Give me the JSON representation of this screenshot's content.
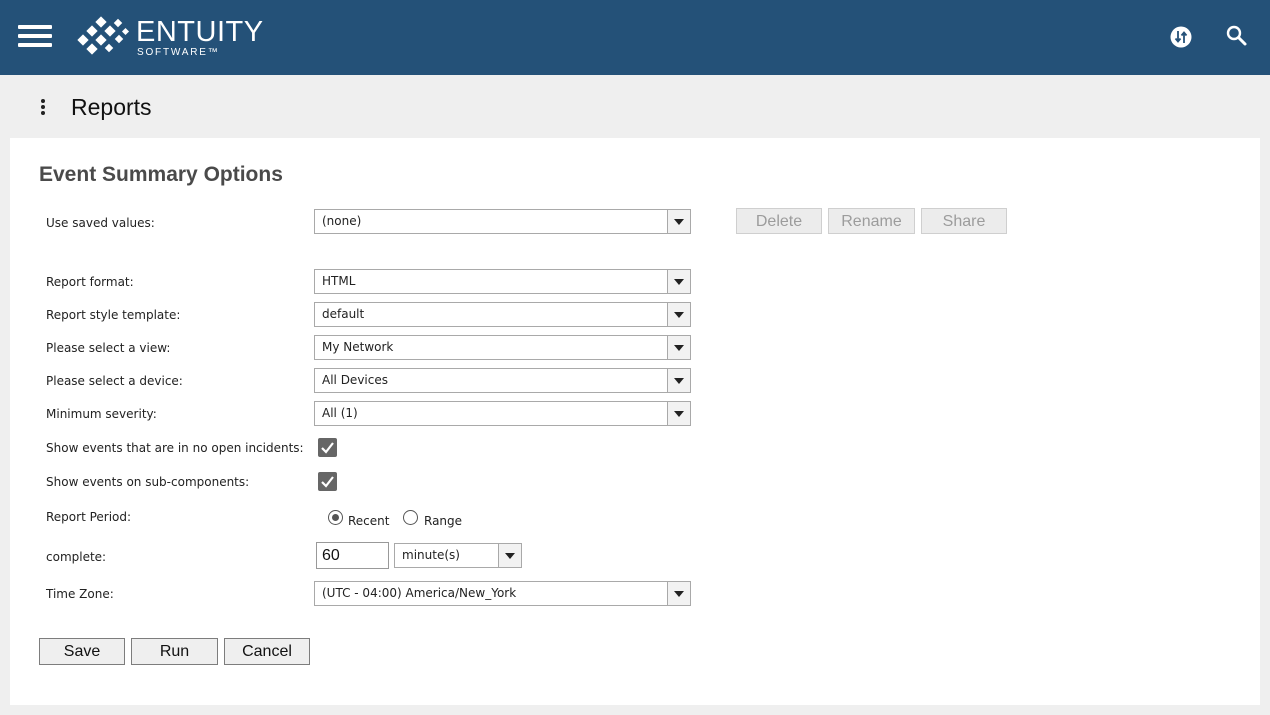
{
  "header": {
    "brand_name": "ENTUITY",
    "brand_sub": "SOFTWARE™",
    "icons": [
      "menu-icon",
      "sync-icon",
      "search-icon"
    ]
  },
  "subheader": {
    "title": "Reports"
  },
  "form": {
    "title": "Event Summary Options",
    "saved_values": {
      "label": "Use saved values:",
      "value": "(none)"
    },
    "saved_buttons": {
      "delete": "Delete",
      "rename": "Rename",
      "share": "Share"
    },
    "report_format": {
      "label": "Report format:",
      "value": "HTML"
    },
    "style_template": {
      "label": "Report style template:",
      "value": "default"
    },
    "view": {
      "label": "Please select a view:",
      "value": "My Network"
    },
    "device": {
      "label": "Please select a device:",
      "value": "All Devices"
    },
    "severity": {
      "label": "Minimum severity:",
      "value": "All (1)"
    },
    "no_open_incidents": {
      "label": "Show events that are in no open incidents:",
      "checked": true
    },
    "sub_components": {
      "label": "Show events on sub-components:",
      "checked": true
    },
    "report_period": {
      "label": "Report Period:",
      "recent": "Recent",
      "range": "Range",
      "selected": "Recent"
    },
    "complete": {
      "label": "complete:",
      "value": "60",
      "unit": "minute(s)"
    },
    "timezone": {
      "label": "Time Zone:",
      "value": "(UTC - 04:00) America/New_York"
    },
    "actions": {
      "save": "Save",
      "run": "Run",
      "cancel": "Cancel"
    }
  },
  "colors": {
    "header_bg": "#245178",
    "page_bg": "#efefef",
    "panel_bg": "#ffffff",
    "checkbox": "#666666"
  }
}
